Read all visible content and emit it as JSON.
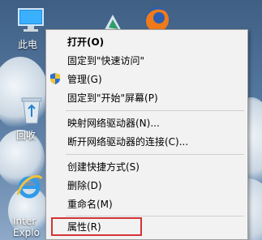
{
  "desktop": {
    "icons": [
      {
        "name": "this-pc",
        "label": "此电"
      },
      {
        "name": "recycle-bin",
        "label": "回收"
      },
      {
        "name": "internet-explorer",
        "label_line1": "Inter",
        "label_line2": "Explo"
      }
    ]
  },
  "context_menu": {
    "items": [
      {
        "label": "打开(O)"
      },
      {
        "label": "固定到\"快速访问\""
      },
      {
        "label": "管理(G)",
        "icon": "uac-shield-icon"
      },
      {
        "label": "固定到\"开始\"屏幕(P)"
      },
      {
        "label": "映射网络驱动器(N)..."
      },
      {
        "label": "断开网络驱动器的连接(C)..."
      },
      {
        "label": "创建快捷方式(S)"
      },
      {
        "label": "删除(D)"
      },
      {
        "label": "重命名(M)"
      },
      {
        "label": "属性(R)"
      }
    ],
    "highlight_color": "#d43434"
  }
}
